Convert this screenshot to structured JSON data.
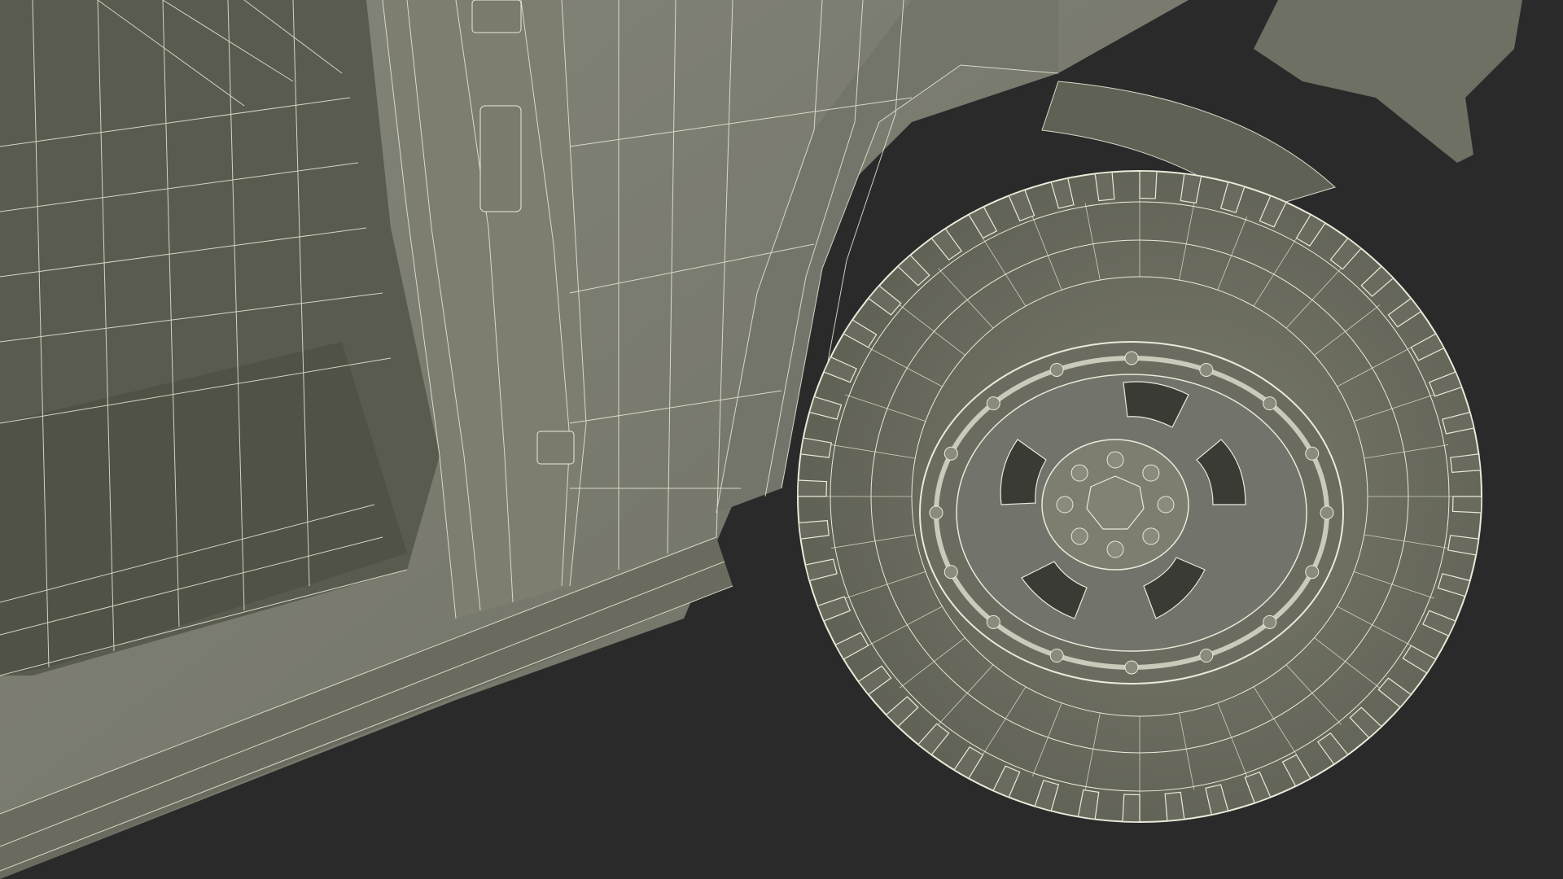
{
  "scene": {
    "subject": "vehicle-wireframe-render",
    "colors": {
      "background": "#2a2a2a",
      "body": "#7b7c6d",
      "body_dark": "#5f6054",
      "body_light": "#8c8d7d",
      "interior": "#55574b",
      "tire": "#6f7063",
      "wire": "#e9ead9",
      "rim": "#6b6c5f"
    }
  }
}
